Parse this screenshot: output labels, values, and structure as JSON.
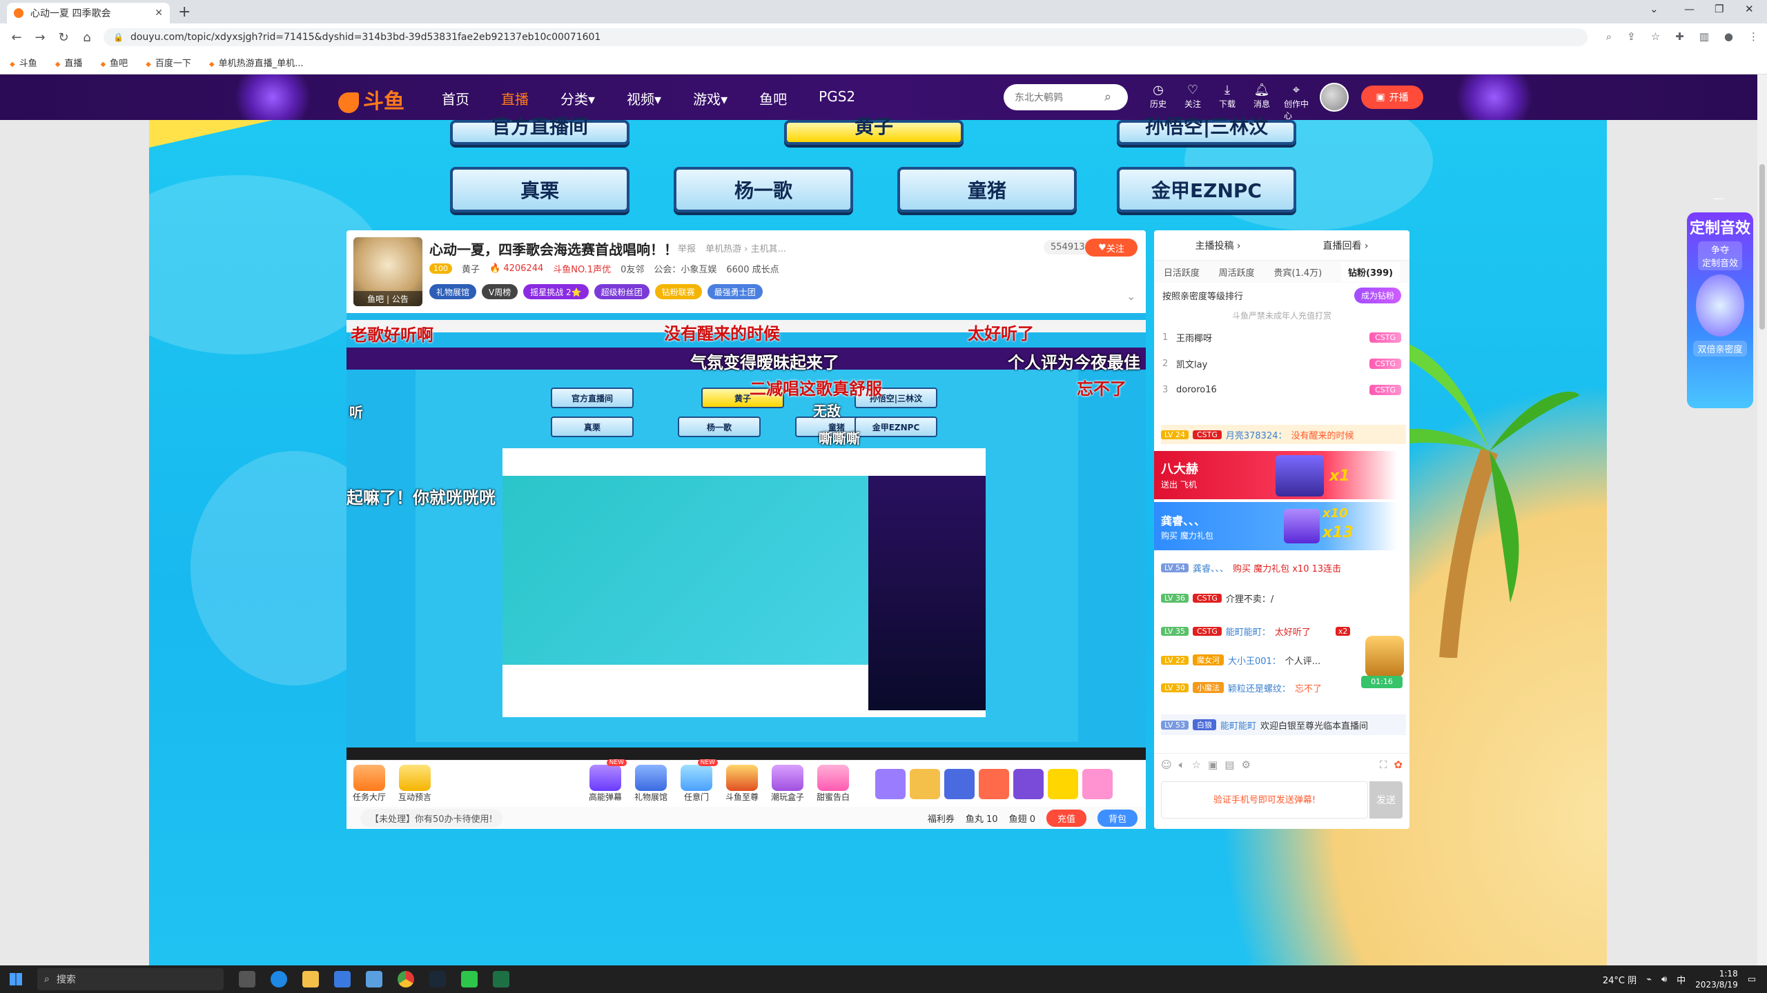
{
  "browser": {
    "tab_title": "心动一夏 四季歌会",
    "url": "douyu.com/topic/xdyxsjgh?rid=71415&dyshid=314b3bd-39d53831fae2eb92137eb10c00071601",
    "bookmarks": [
      "斗鱼",
      "直播",
      "鱼吧",
      "百度一下",
      "单机热游直播_单机..."
    ]
  },
  "site": {
    "logo_text": "斗鱼",
    "nav": [
      "首页",
      "直播",
      "分类▾",
      "视频▾",
      "游戏▾",
      "鱼吧",
      "PGS2"
    ],
    "active_nav": "直播",
    "search_placeholder": "东北大鹌鹑",
    "header_icons": [
      "历史",
      "关注",
      "下载",
      "消息",
      "创作中心"
    ],
    "live_button": "开播"
  },
  "categories": {
    "partial_row": [
      "官方直播间",
      "黄子",
      "孙悟空|三林汶"
    ],
    "row": [
      "真栗",
      "杨一歌",
      "童猪",
      "金甲EZNPC"
    ]
  },
  "room": {
    "title": "心动一夏，四季歌会海选赛首战唱响！！",
    "report": "举报",
    "category": "单机热游 › 主机其...",
    "avatar_tags": "鱼吧 | 公告",
    "level": "100",
    "anchor_name": "黄子",
    "heat": "4206244",
    "rank_tag": "斗鱼NO.1声优",
    "friends": "0友邻",
    "guild": "公会：小象互娱",
    "points": "6600 成长点",
    "badges": [
      "礼物展馆",
      "V周榜",
      "摇星挑战 2⭐",
      "超级粉丝团",
      "钻粉联赛",
      "最强勇士团"
    ],
    "fans_count": "5549136",
    "follow": "关注"
  },
  "danmu": [
    "老歌好听啊",
    "没有醒来的时候",
    "太好听了",
    "气氛变得暧昧起来了",
    "个人评为今夜最佳",
    "二减唱这歌真舒服",
    "忘不了",
    "无敌",
    "嘶嘶嘶",
    "起嘛了！你就咣咣咣",
    "听"
  ],
  "toolbar": {
    "tools": [
      "任务大厅",
      "互动预言",
      "高能弹幕",
      "礼物展馆",
      "任意门",
      "斗鱼至尊",
      "潮玩盒子",
      "甜蜜告白"
    ],
    "new_tags": [
      "高能弹幕",
      "任意门"
    ],
    "notice": "【未处理】你有50办卡待使用!",
    "welfare": "福利券",
    "fish_balls": "鱼丸 10",
    "fish_fins": "鱼翅 0",
    "recharge": "充值",
    "bag": "背包"
  },
  "side": {
    "links": [
      "主播投稿 ›",
      "直播回看 ›"
    ],
    "tabs": [
      "日活跃度",
      "周活跃度",
      "贵宾(1.4万)",
      "钻粉(399)"
    ],
    "active_tab": "钻粉(399)",
    "rank_title": "按照亲密度等级排行",
    "become_fan": "成为钻粉",
    "rank_tip": "斗鱼严禁未成年人充值打赏",
    "rank": [
      {
        "num": "1",
        "name": "王雨椰呀",
        "badge": "CSTG"
      },
      {
        "num": "2",
        "name": "凯文lay",
        "badge": "CSTG"
      },
      {
        "num": "3",
        "name": "dororo16",
        "badge": "CSTG"
      }
    ],
    "chat": [
      {
        "lv": "LV 24",
        "badge": "CSTG",
        "nick": "月亮378324：",
        "text": "没有醒来的时候"
      },
      {
        "lv": "LV 54",
        "badge": "",
        "nick": "龚睿、、、",
        "text": "购买 魔力礼包 x10 13连击"
      },
      {
        "lv": "LV 36",
        "badge": "CSTG",
        "nick": "",
        "text": "介狸不卖：/"
      },
      {
        "lv": "LV 35",
        "badge": "CSTG",
        "nick": "能町能町：",
        "text": "太好听了"
      },
      {
        "lv": "LV 22",
        "badge": "魔女河",
        "nick": "大小王001：",
        "text": "个人评..."
      },
      {
        "lv": "LV 30",
        "badge": "小魔法",
        "nick": "颖粒还是螺纹：",
        "text": "忘不了"
      },
      {
        "lv": "LV 53",
        "badge": "白狼",
        "nick": "能町能町",
        "text": "欢迎白银至尊光临本直播间"
      }
    ],
    "gift_banner_1": {
      "user": "八大赫",
      "action": "送出  飞机",
      "count": "x1"
    },
    "gift_banner_2": {
      "user": "龚睿、、、",
      "action": "购买  魔力礼包",
      "count1": "x10",
      "count2": "x13"
    },
    "timer": "01:16",
    "combo": "x2",
    "chat_placeholder": "验证手机号即可发送弹幕!",
    "send": "发送"
  },
  "promo": {
    "title": "定制音效",
    "subtitle": "争夺\n定制音效",
    "footer": "双倍亲密度"
  },
  "taskbar": {
    "search": "搜索",
    "weather": "24°C 阴",
    "time": "1:18",
    "date": "2023/8/19",
    "ime": "中"
  },
  "colors": {
    "brand_orange": "#ff7a1a",
    "header_purple": "#3a0f6e",
    "ocean_blue": "#1ec8f2"
  }
}
